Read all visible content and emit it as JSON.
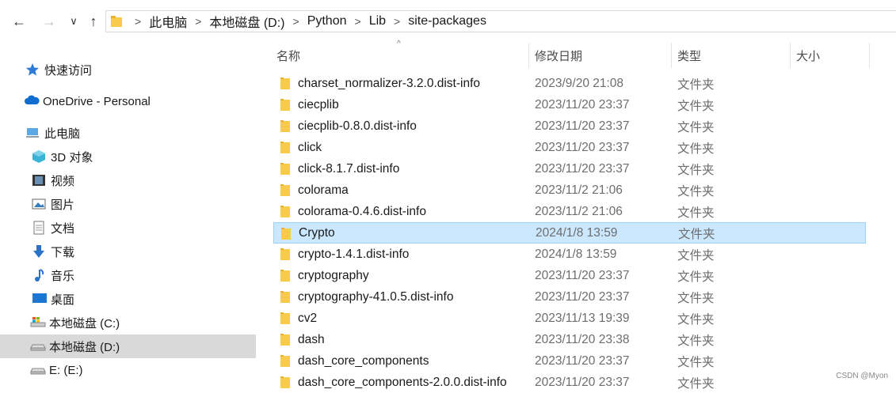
{
  "address": {
    "back_glyph": "←",
    "forward_glyph": "→",
    "dropdown_glyph": "∨",
    "up_glyph": "↑",
    "separator": ">",
    "crumbs": [
      "此电脑",
      "本地磁盘 (D:)",
      "Python",
      "Lib",
      "site-packages"
    ]
  },
  "sidebar": {
    "items": [
      {
        "label": "快速访问",
        "icon": "star-icon"
      },
      {
        "label": "OneDrive - Personal",
        "icon": "cloud-icon"
      },
      {
        "label": "此电脑",
        "icon": "computer-icon"
      },
      {
        "label": "3D 对象",
        "icon": "cube-icon"
      },
      {
        "label": "视频",
        "icon": "video-icon"
      },
      {
        "label": "图片",
        "icon": "picture-icon"
      },
      {
        "label": "文档",
        "icon": "document-icon"
      },
      {
        "label": "下载",
        "icon": "download-icon"
      },
      {
        "label": "音乐",
        "icon": "music-icon"
      },
      {
        "label": "桌面",
        "icon": "desktop-icon"
      },
      {
        "label": "本地磁盘 (C:)",
        "icon": "drive-c-icon"
      },
      {
        "label": "本地磁盘 (D:)",
        "icon": "drive-icon",
        "selected": true
      },
      {
        "label": "E: (E:)",
        "icon": "drive-icon"
      }
    ]
  },
  "columns": {
    "name": "名称",
    "modified": "修改日期",
    "type": "类型",
    "size": "大小"
  },
  "files": [
    {
      "name": "charset_normalizer-3.2.0.dist-info",
      "modified": "2023/9/20 21:08",
      "type": "文件夹"
    },
    {
      "name": "ciecplib",
      "modified": "2023/11/20 23:37",
      "type": "文件夹"
    },
    {
      "name": "ciecplib-0.8.0.dist-info",
      "modified": "2023/11/20 23:37",
      "type": "文件夹"
    },
    {
      "name": "click",
      "modified": "2023/11/20 23:37",
      "type": "文件夹"
    },
    {
      "name": "click-8.1.7.dist-info",
      "modified": "2023/11/20 23:37",
      "type": "文件夹"
    },
    {
      "name": "colorama",
      "modified": "2023/11/2 21:06",
      "type": "文件夹"
    },
    {
      "name": "colorama-0.4.6.dist-info",
      "modified": "2023/11/2 21:06",
      "type": "文件夹"
    },
    {
      "name": "Crypto",
      "modified": "2024/1/8 13:59",
      "type": "文件夹",
      "selected": true
    },
    {
      "name": "crypto-1.4.1.dist-info",
      "modified": "2024/1/8 13:59",
      "type": "文件夹"
    },
    {
      "name": "cryptography",
      "modified": "2023/11/20 23:37",
      "type": "文件夹"
    },
    {
      "name": "cryptography-41.0.5.dist-info",
      "modified": "2023/11/20 23:37",
      "type": "文件夹"
    },
    {
      "name": "cv2",
      "modified": "2023/11/13 19:39",
      "type": "文件夹"
    },
    {
      "name": "dash",
      "modified": "2023/11/20 23:38",
      "type": "文件夹"
    },
    {
      "name": "dash_core_components",
      "modified": "2023/11/20 23:37",
      "type": "文件夹"
    },
    {
      "name": "dash_core_components-2.0.0.dist-info",
      "modified": "2023/11/20 23:37",
      "type": "文件夹"
    }
  ],
  "watermark": "CSDN @Myon⁠",
  "colors": {
    "selection_bg": "#cce8ff",
    "selection_border": "#99d1ff",
    "sidebar_selected": "#d9d9d9",
    "folder": "#f8cc4a"
  }
}
